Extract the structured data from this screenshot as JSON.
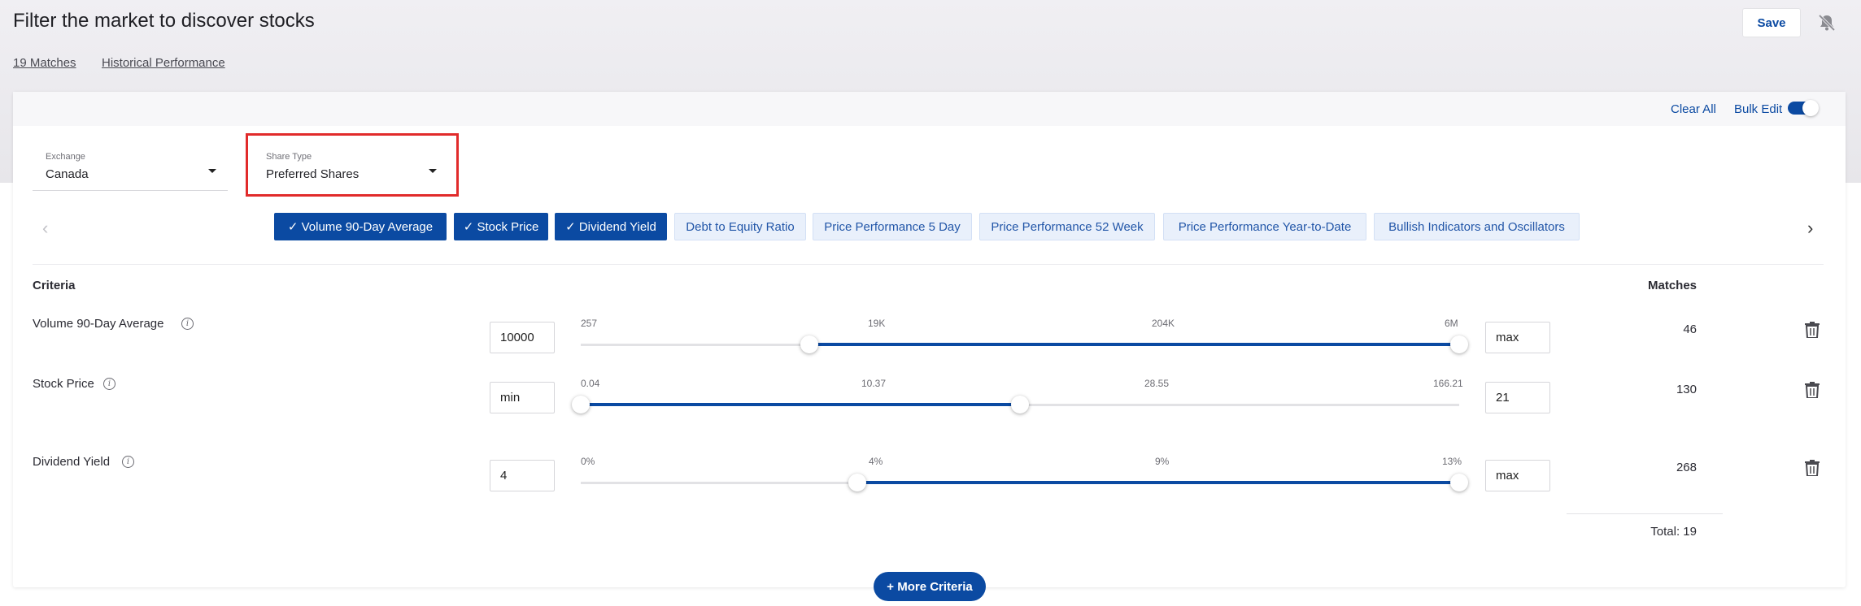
{
  "page": {
    "title": "Filter the market to discover stocks",
    "save_label": "Save",
    "links": [
      "19 Matches",
      "Historical Performance"
    ]
  },
  "toolbar": {
    "clear_all": "Clear All",
    "bulk_edit": "Bulk Edit",
    "bulk_edit_on": true
  },
  "filters": {
    "exchange": {
      "label": "Exchange",
      "value": "Canada"
    },
    "share_type": {
      "label": "Share Type",
      "value": "Preferred Shares"
    }
  },
  "chips": [
    {
      "label": "✓ Volume 90-Day Average",
      "selected": true
    },
    {
      "label": "✓ Stock Price",
      "selected": true
    },
    {
      "label": "✓ Dividend Yield",
      "selected": true
    },
    {
      "label": "Debt to Equity Ratio",
      "selected": false
    },
    {
      "label": "Price Performance 5 Day",
      "selected": false
    },
    {
      "label": "Price Performance 52 Week",
      "selected": false
    },
    {
      "label": "Price Performance Year-to-Date",
      "selected": false
    },
    {
      "label": "Bullish Indicators and Oscillators",
      "selected": false
    }
  ],
  "nav": {
    "prev": "‹",
    "next": "›"
  },
  "table": {
    "criteria_header": "Criteria",
    "matches_header": "Matches",
    "rows": [
      {
        "name": "Volume 90-Day Average",
        "min": "10000",
        "max": "max",
        "ticks": [
          "257",
          "19K",
          "204K",
          "6M"
        ],
        "range": [
          0.26,
          1.0
        ],
        "matches": "46"
      },
      {
        "name": "Stock Price",
        "min": "min",
        "max": "21",
        "ticks": [
          "0.04",
          "10.37",
          "28.55",
          "166.21"
        ],
        "range": [
          0.0,
          0.5
        ],
        "matches": "130"
      },
      {
        "name": "Dividend Yield",
        "min": "4",
        "max": "max",
        "ticks": [
          "0%",
          "4%",
          "9%",
          "13%"
        ],
        "range": [
          0.315,
          1.0
        ],
        "matches": "268"
      }
    ],
    "total": "Total: 19"
  },
  "more_criteria": "+ More Criteria",
  "colors": {
    "accent": "#0b4aa2",
    "highlight": "#e12b2b"
  }
}
